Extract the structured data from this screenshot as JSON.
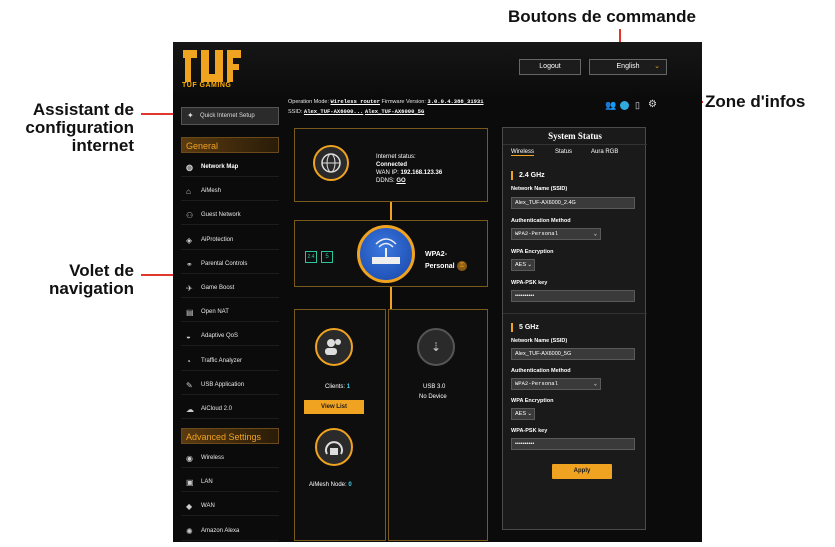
{
  "annotations": {
    "top": "Boutons de commande",
    "right": "Zone d'infos",
    "left1": [
      "Assistant de",
      "configuration",
      "internet"
    ],
    "left2": [
      "Volet de",
      "navigation"
    ]
  },
  "app": {
    "logo_text": "TUF GAMING",
    "logout_label": "Logout",
    "language": "English"
  },
  "infobar": {
    "operation_mode_label": "Operation Mode:",
    "operation_mode_value": "Wireless router",
    "firmware_label": "Firmware Version:",
    "firmware_value": "3.0.0.4.388_31931",
    "ssid_label": "SSID:",
    "ssid_1": "Alex_TUF-AX6000...",
    "ssid_2": "Alex_TUF-AX6000_5G"
  },
  "sidebar": {
    "quick_setup": "Quick Internet Setup",
    "general_header": "General",
    "general_items": [
      "Network Map",
      "AiMesh",
      "Guest Network",
      "AiProtection",
      "Parental Controls",
      "Game Boost",
      "Open NAT",
      "Adaptive QoS",
      "Traffic Analyzer",
      "USB Application",
      "AiCloud 2.0"
    ],
    "advanced_header": "Advanced Settings",
    "advanced_items": [
      "Wireless",
      "LAN",
      "WAN",
      "Amazon Alexa"
    ]
  },
  "network_map": {
    "internet_status_label": "Internet status:",
    "internet_status_value": "Connected",
    "wan_ip_label": "WAN IP:",
    "wan_ip_value": "192.168.123.36",
    "ddns_label": "DDNS:",
    "ddns_value": "GO",
    "band_24": "2.4",
    "band_5": "5",
    "security_line1": "WPA2-",
    "security_line2": "Personal",
    "clients_label": "Clients:",
    "clients_count": "1",
    "view_list": "View List",
    "usb_label": "USB 3.0",
    "usb_status": "No Device",
    "aimesh_label": "AiMesh Node:",
    "aimesh_count": "0"
  },
  "system_status": {
    "title": "System Status",
    "tabs": [
      "Wireless",
      "Status",
      "Aura RGB"
    ],
    "band24": {
      "header": "2.4 GHz",
      "ssid_label": "Network Name (SSID)",
      "ssid_value": "Alex_TUF-AX6000_2.4G",
      "auth_label": "Authentication Method",
      "auth_value": "WPA2-Personal",
      "enc_label": "WPA Encryption",
      "enc_value": "AES",
      "key_label": "WPA-PSK key",
      "key_value": "••••••••••"
    },
    "band5": {
      "header": "5 GHz",
      "ssid_label": "Network Name (SSID)",
      "ssid_value": "Alex_TUF-AX6000_5G",
      "auth_label": "Authentication Method",
      "auth_value": "WPA2-Personal",
      "enc_label": "WPA Encryption",
      "enc_value": "AES",
      "key_label": "WPA-PSK key",
      "key_value": "••••••••••"
    },
    "apply_label": "Apply"
  },
  "colors": {
    "accent": "#f0a320",
    "annotation_line": "#e0362c",
    "background": "#0b0b0c"
  }
}
